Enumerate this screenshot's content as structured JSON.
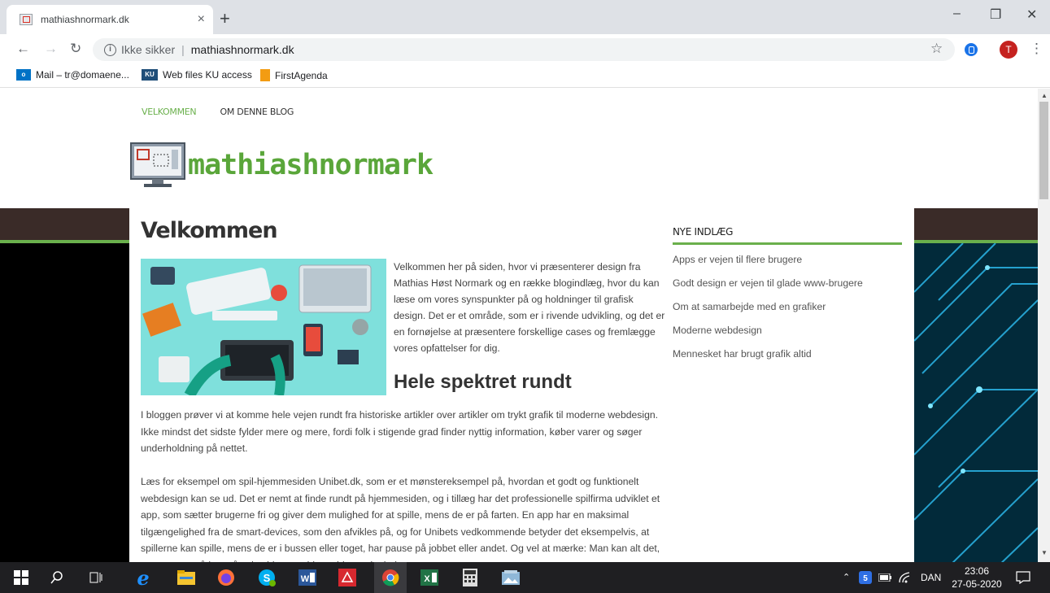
{
  "browser": {
    "tab_title": "mathiashnormark.dk",
    "new_tab": "+",
    "close_tab": "×",
    "address_insecure": "Ikke sikker",
    "address_separator": "|",
    "address_url": "mathiashnormark.dk",
    "profile_initial": "T",
    "bookmarks": [
      {
        "label": "Mail – tr@domaene...",
        "color": "#0072c6",
        "icon_text": "o"
      },
      {
        "label": "Web files KU access",
        "color": "#1f4e79",
        "icon_text": "KU"
      },
      {
        "label": "FirstAgenda",
        "color": "#f39c12",
        "icon_text": ""
      }
    ]
  },
  "site": {
    "nav": [
      "VELKOMMEN",
      "OM DENNE BLOG"
    ],
    "logo_text": "mathiashnormark",
    "page_title": "Velkommen",
    "intro": "Velkommen her på siden, hvor vi præsenterer design fra Mathias Høst Normark og en række blogindlæg, hvor du kan læse om vores synspunkter på og holdninger til grafisk design. Det er et område, som er i rivende udvikling, og det er en fornøjelse at præsentere forskellige cases og fremlægge vores opfattelser for dig.",
    "section_title": "Hele spektret rundt",
    "paragraph1": "I bloggen prøver vi at komme hele vejen rundt fra historiske artikler over artikler om trykt grafik til moderne webdesign. Ikke mindst det sidste fylder mere og mere, fordi folk i stigende grad finder nyttig information, køber varer og søger underholdning på nettet.",
    "paragraph2": "Læs for eksempel om spil-hjemmesiden Unibet.dk, som er et mønstereksempel på, hvordan et godt og funktionelt webdesign kan se ud. Det er nemt at finde rundt på hjemmesiden, og i tillæg har det professionelle spilfirma udviklet et app, som sætter brugerne fri og giver dem mulighed for at spille, mens de er på farten. En app har en maksimal tilgængelighed fra de smart-devices, som den afvikles på, og for Unibets vedkommende betyder det eksempelvis, at spillerne kan spille, mens de er i bussen eller toget, har pause på jobbet eller andet. Og vel at mærke: Man kan alt det, som man også kan på selve hjemmesiden – blot er det hele",
    "sidebar_title": "NYE INDLÆG",
    "sidebar_items": [
      "Apps er vejen til flere brugere",
      "Godt design er vejen til glade www-brugere",
      "Om at samarbejde med en grafiker",
      "Moderne webdesign",
      "Mennesket har brugt grafik altid"
    ],
    "colors": {
      "accent_green": "#6ab04c",
      "band_brown": "#3a2b28"
    }
  },
  "taskbar": {
    "language": "DAN",
    "time": "23:06",
    "date": "27-05-2020"
  }
}
